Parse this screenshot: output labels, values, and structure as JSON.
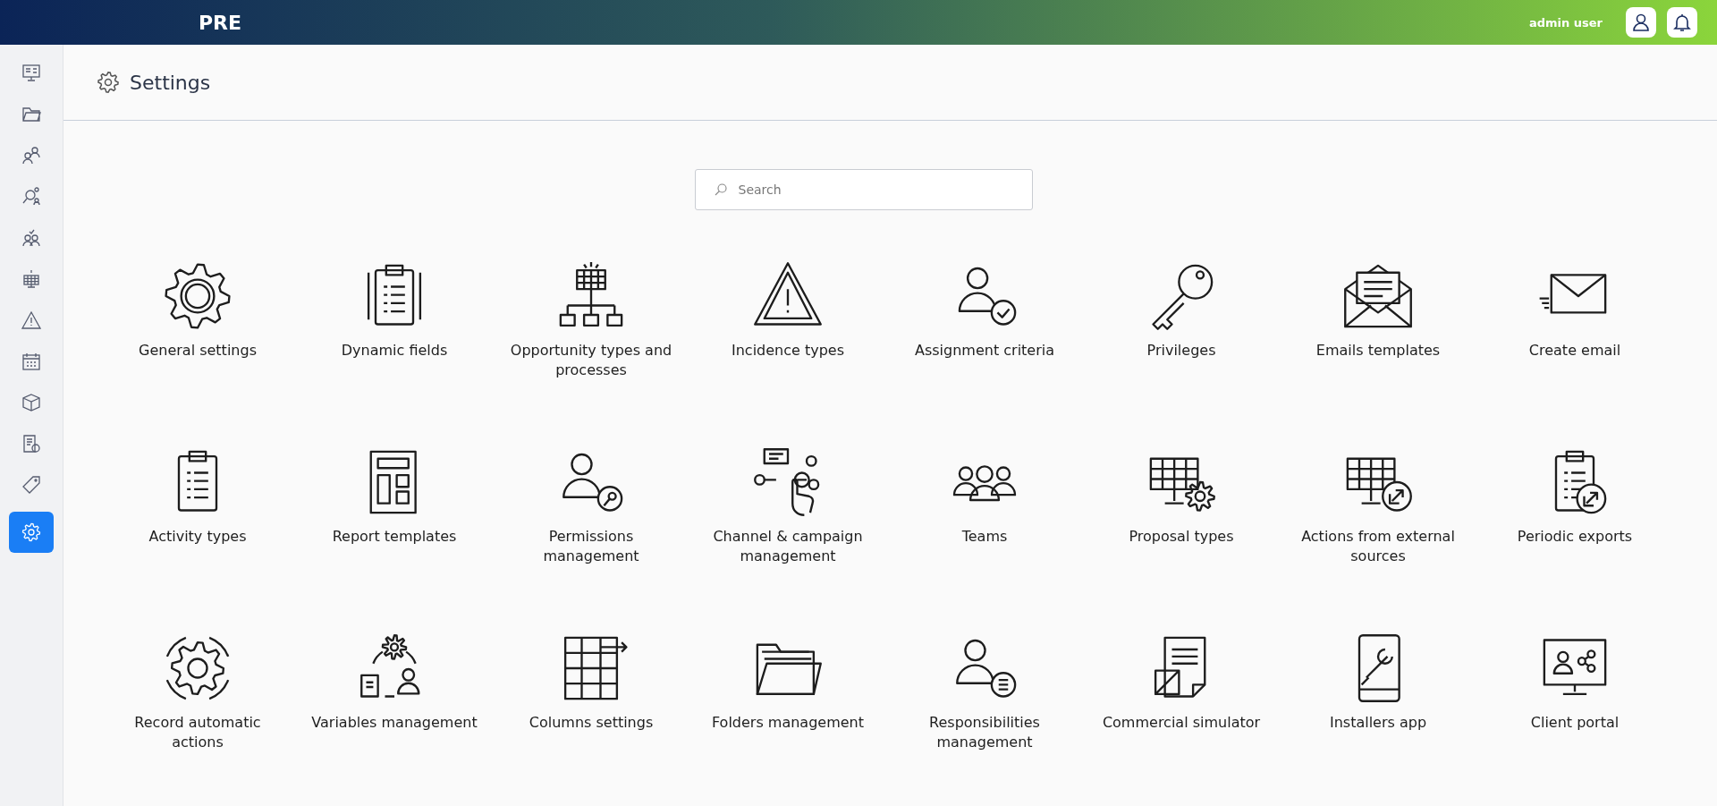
{
  "top_bar": {
    "logo": "PRE",
    "user_name": "admin user"
  },
  "sidebar": {
    "items": [
      {
        "selected": false
      },
      {
        "selected": false
      },
      {
        "selected": false
      },
      {
        "selected": false
      },
      {
        "selected": false
      },
      {
        "selected": false
      },
      {
        "selected": false
      },
      {
        "selected": false
      },
      {
        "selected": false
      },
      {
        "selected": false
      },
      {
        "selected": false
      },
      {
        "selected": true
      }
    ]
  },
  "page": {
    "title": "Settings"
  },
  "search": {
    "placeholder": "Search"
  },
  "tiles": [
    {
      "label": "General settings"
    },
    {
      "label": "Dynamic fields"
    },
    {
      "label": "Opportunity types and processes"
    },
    {
      "label": "Incidence types"
    },
    {
      "label": "Assignment criteria"
    },
    {
      "label": "Privileges"
    },
    {
      "label": "Emails templates"
    },
    {
      "label": "Create email"
    },
    {
      "label": "Activity types"
    },
    {
      "label": "Report templates"
    },
    {
      "label": "Permissions management"
    },
    {
      "label": "Channel & campaign management"
    },
    {
      "label": "Teams"
    },
    {
      "label": "Proposal types"
    },
    {
      "label": "Actions from external sources"
    },
    {
      "label": "Periodic exports"
    },
    {
      "label": "Record automatic actions"
    },
    {
      "label": "Variables management"
    },
    {
      "label": "Columns settings"
    },
    {
      "label": "Folders management"
    },
    {
      "label": "Responsibilities management"
    },
    {
      "label": "Commercial simulator"
    },
    {
      "label": "Installers app"
    },
    {
      "label": "Client portal"
    }
  ]
}
